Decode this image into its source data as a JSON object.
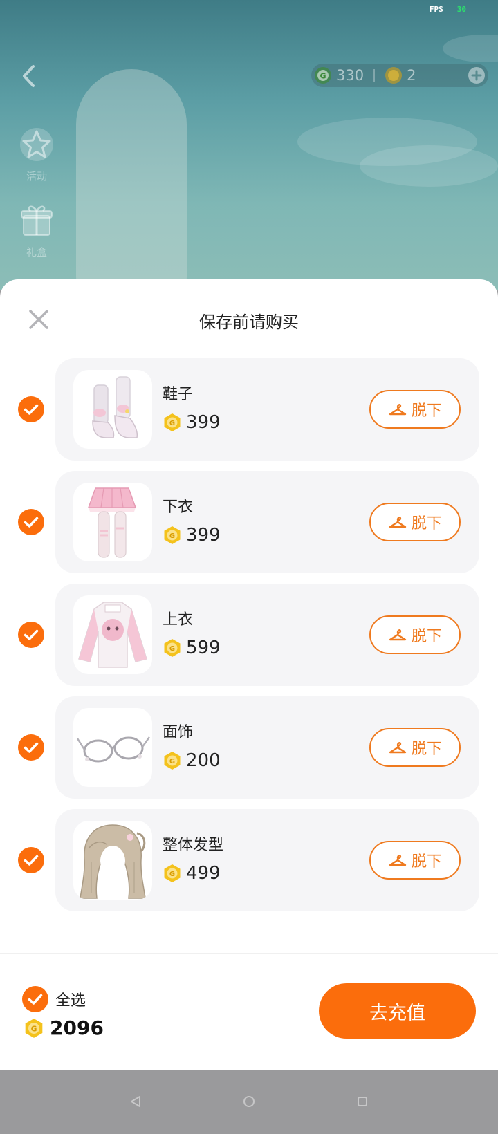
{
  "status": {
    "fps_label": "FPS",
    "fps_value": "30"
  },
  "topbar": {
    "currency_primary": "330",
    "currency_secondary": "2"
  },
  "sidebar": {
    "entries": [
      {
        "label": "活动",
        "icon": "star-icon"
      },
      {
        "label": "礼盒",
        "icon": "gift-icon"
      }
    ]
  },
  "sheet": {
    "title": "保存前请购买",
    "items": [
      {
        "name": "鞋子",
        "price": "399",
        "action": "脱下",
        "checked": true,
        "thumb": "boots-thumbnail"
      },
      {
        "name": "下衣",
        "price": "399",
        "action": "脱下",
        "checked": true,
        "thumb": "skirt-thumbnail"
      },
      {
        "name": "上衣",
        "price": "599",
        "action": "脱下",
        "checked": true,
        "thumb": "sweater-thumbnail"
      },
      {
        "name": "面饰",
        "price": "200",
        "action": "脱下",
        "checked": true,
        "thumb": "glasses-thumbnail"
      },
      {
        "name": "整体发型",
        "price": "499",
        "action": "脱下",
        "checked": true,
        "thumb": "hairstyle-thumbnail"
      }
    ],
    "select_all_label": "全选",
    "total": "2096",
    "recharge_label": "去充值"
  },
  "colors": {
    "accent": "#fb6d0c",
    "outline_accent": "#ef7a1f",
    "coin": "#f4c21c",
    "card_bg": "#f5f5f7"
  }
}
